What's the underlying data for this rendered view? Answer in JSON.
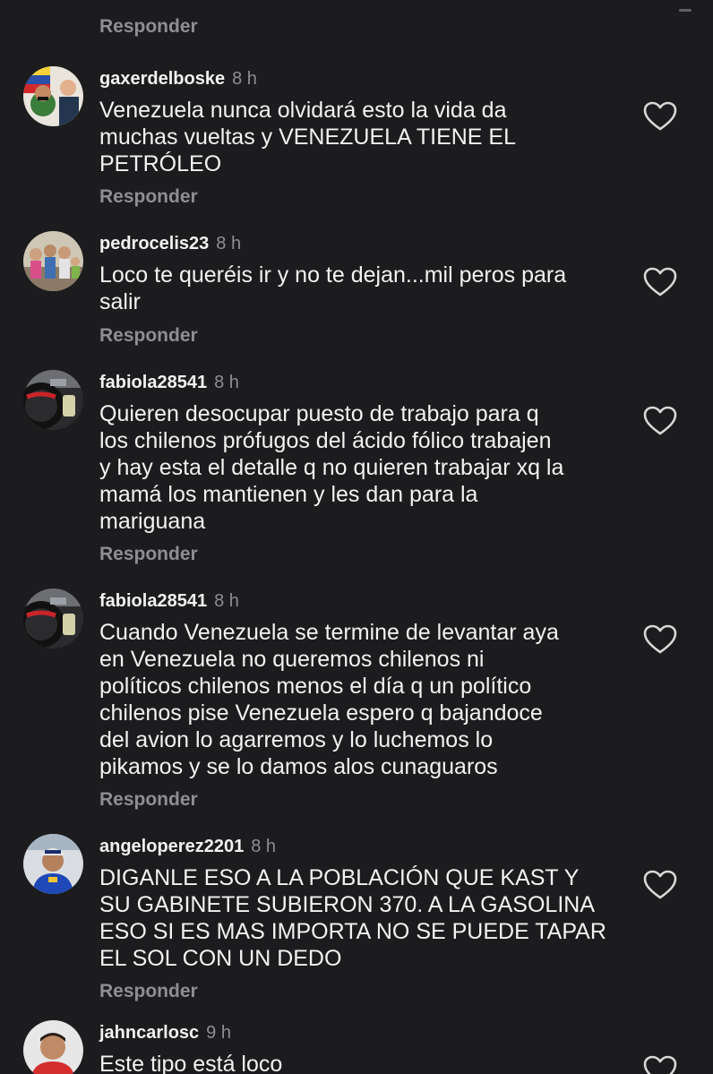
{
  "reply_label": "Responder",
  "comments": [
    {
      "username": "gaxerdelboske",
      "time": "8 h",
      "text": "Venezuela nunca olvidará esto la vida da\nmuchas vueltas y VENEZUELA TIENE EL\nPETRÓLEO",
      "avatar": "avatar-flag-icon"
    },
    {
      "username": "pedrocelis23",
      "time": "8 h",
      "text": "Loco te queréis ir y no te dejan...mil peros para\nsalir",
      "avatar": "avatar-group-photo-icon"
    },
    {
      "username": "fabiola28541",
      "time": "8 h",
      "text": "Quieren desocupar puesto de trabajo para q\nlos chilenos prófugos del ácido fólico trabajen\ny hay esta el detalle q no quieren trabajar xq la\nmamá los mantienen y les dan para la\nmariguana",
      "avatar": "avatar-car-interior-icon"
    },
    {
      "username": "fabiola28541",
      "time": "8 h",
      "text": "Cuando Venezuela se termine de levantar aya\nen Venezuela no queremos chilenos ni\npolíticos chilenos menos el día q un político\nchilenos pise Venezuela espero q bajandoce\ndel avion lo agarremos y lo luchemos lo\npikamos y se lo damos alos cunaguaros",
      "avatar": "avatar-car-interior-icon"
    },
    {
      "username": "angeloperez2201",
      "time": "8 h",
      "text": "DIGANLE ESO A LA POBLACIÓN  QUE KAST Y\nSU GABINETE SUBIERON 370. A LA GASOLINA\nESO SI ES MAS IMPORTA NO SE PUEDE TAPAR\nEL SOL CON UN DEDO",
      "avatar": "avatar-person-cap-icon"
    },
    {
      "username": "jahncarlosc",
      "time": "9 h",
      "text": "Este tipo está loco",
      "avatar": "avatar-person-icon"
    }
  ]
}
